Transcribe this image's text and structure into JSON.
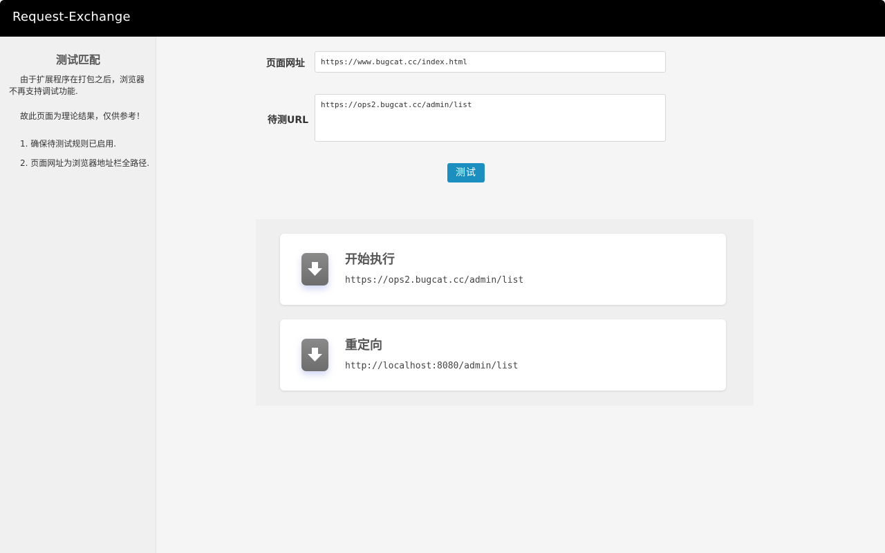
{
  "header": {
    "title": "Request-Exchange"
  },
  "sidebar": {
    "heading": "测试匹配",
    "para1": "由于扩展程序在打包之后，浏览器不再支持调试功能.",
    "para2": "故此页面为理论结果，仅供参考！",
    "items": [
      {
        "label": "1. 确保待测试规则已启用."
      },
      {
        "label": "2. 页面网址为浏览器地址栏全路径."
      }
    ]
  },
  "form": {
    "page_url_label": "页面网址",
    "page_url_value": "https://www.bugcat.cc/index.html",
    "test_url_label": "待测URL",
    "test_url_value": "https://ops2.bugcat.cc/admin/list",
    "test_button": "测试"
  },
  "results": [
    {
      "title": "开始执行",
      "value": "https://ops2.bugcat.cc/admin/list",
      "icon": "arrow-down-icon"
    },
    {
      "title": "重定向",
      "value": "http://localhost:8080/admin/list",
      "icon": "arrow-down-icon"
    }
  ],
  "colors": {
    "header_bg": "#000000",
    "button": "#1a8fc0",
    "icon_bg": "#7a7a7a"
  }
}
